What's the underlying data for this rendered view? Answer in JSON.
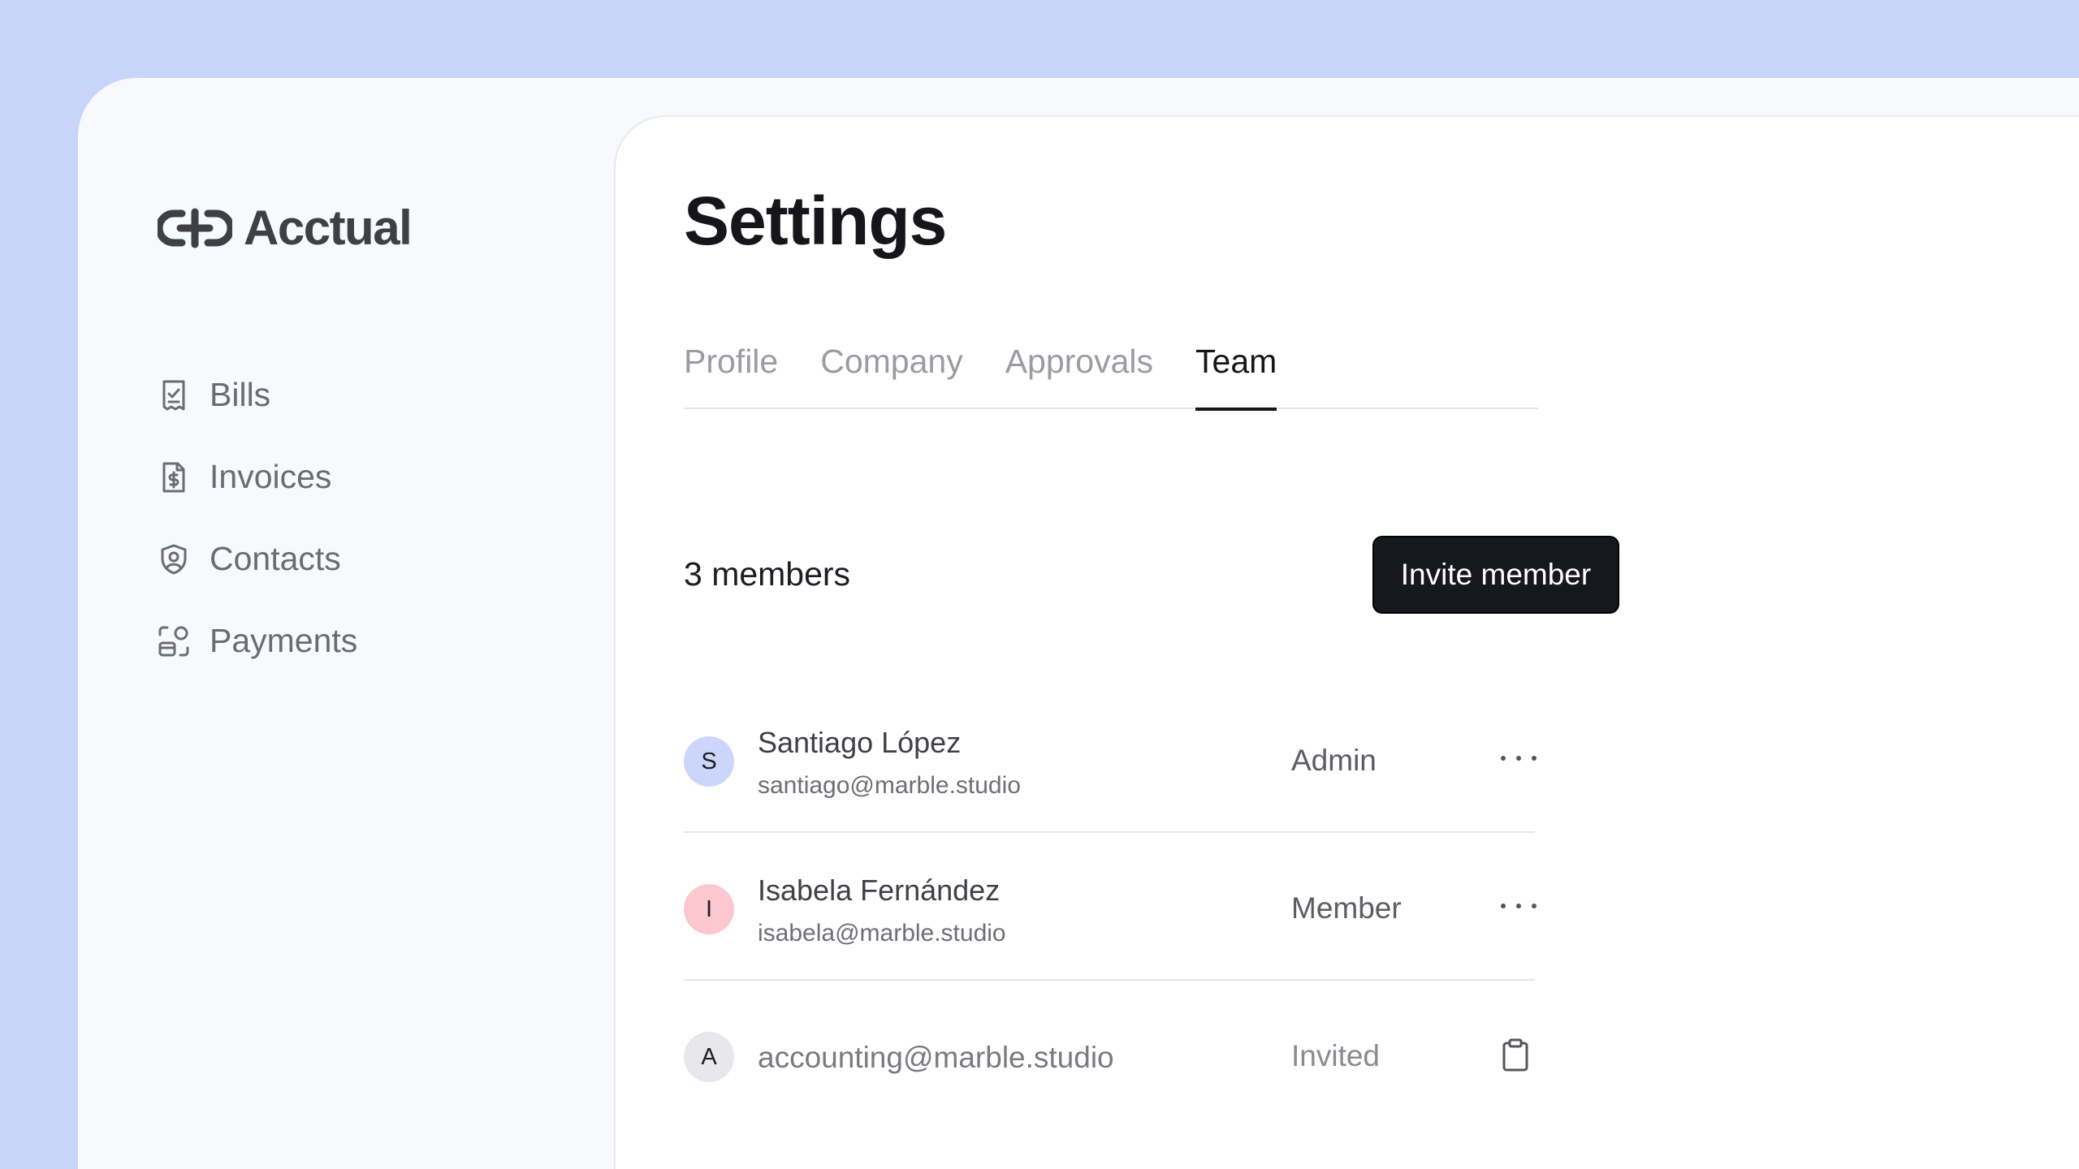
{
  "brand": {
    "name": "Acctual"
  },
  "sidebar": {
    "items": [
      {
        "label": "Bills",
        "icon": "receipt-check-icon"
      },
      {
        "label": "Invoices",
        "icon": "dollar-document-icon"
      },
      {
        "label": "Contacts",
        "icon": "shield-user-icon"
      },
      {
        "label": "Payments",
        "icon": "payments-icon"
      }
    ]
  },
  "page": {
    "title": "Settings"
  },
  "tabs": [
    {
      "label": "Profile",
      "active": false
    },
    {
      "label": "Company",
      "active": false
    },
    {
      "label": "Approvals",
      "active": false
    },
    {
      "label": "Team",
      "active": true
    }
  ],
  "team": {
    "count_label": "3 members",
    "invite_label": "Invite member",
    "members": [
      {
        "initial": "S",
        "name": "Santiago López",
        "email": "santiago@marble.studio",
        "role": "Admin",
        "avatar_color": "#ccd6fb"
      },
      {
        "initial": "I",
        "name": "Isabela Fernández",
        "email": "isabela@marble.studio",
        "role": "Member",
        "avatar_color": "#fcc7ce"
      },
      {
        "initial": "A",
        "email": "accounting@marble.studio",
        "role": "Invited",
        "avatar_color": "#e8e8ec"
      }
    ]
  },
  "colors": {
    "background": "#c9d5f8",
    "button": "#17181d",
    "active_tab": "#16161a"
  }
}
